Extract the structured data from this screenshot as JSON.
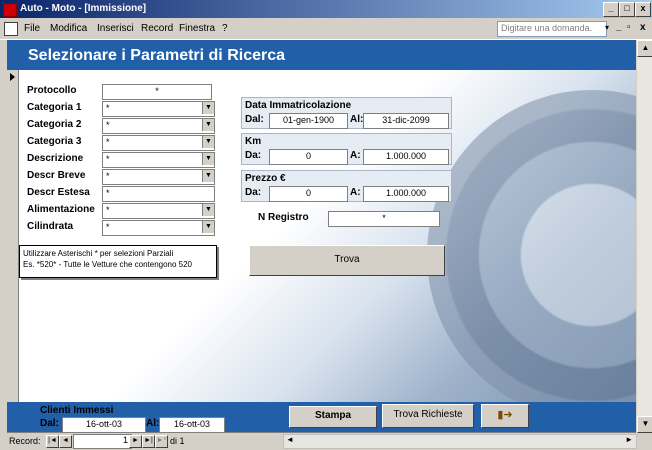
{
  "window": {
    "title": "Auto - Moto - [Immissione]",
    "buttons": {
      "minimize": "_",
      "restore": "□",
      "close": "x"
    }
  },
  "menu": {
    "items": [
      "File",
      "Modifica",
      "Inserisci",
      "Record",
      "Finestra",
      "?"
    ],
    "help_placeholder": "Digitare una domanda.",
    "mdi_buttons": {
      "minimize": "_",
      "restore": "▫",
      "close": "x"
    }
  },
  "header": {
    "title": "Selezionare i Parametri di Ricerca"
  },
  "fields": {
    "protocollo": {
      "label": "Protocollo",
      "value": "*"
    },
    "categoria1": {
      "label": "Categoria 1",
      "value": "*"
    },
    "categoria2": {
      "label": "Categoria 2",
      "value": "*"
    },
    "categoria3": {
      "label": "Categoria 3",
      "value": "*"
    },
    "descrizione": {
      "label": "Descrizione",
      "value": "*"
    },
    "descr_breve": {
      "label": "Descr Breve",
      "value": "*"
    },
    "descr_estesa": {
      "label": "Descr Estesa",
      "value": "*"
    },
    "alimentazione": {
      "label": "Alimentazione",
      "value": "*"
    },
    "cilindrata": {
      "label": "Cilindrata",
      "value": "*"
    }
  },
  "note": {
    "line1": "Utilizzare Asterischi * per selezioni Parziali",
    "line2": "Es. *520* - Tutte le Vetture che contengono 520"
  },
  "immatricolazione": {
    "title": "Data Immatricolazione",
    "from_label": "Dal:",
    "from": "01-gen-1900",
    "to_label": "Al:",
    "to": "31-dic-2099"
  },
  "km": {
    "title": "Km",
    "from_label": "Da:",
    "from": "0",
    "to_label": "A:",
    "to": "1.000.000"
  },
  "prezzo": {
    "title": "Prezzo €",
    "from_label": "Da:",
    "from": "0",
    "to_label": "A:",
    "to": "1.000.000"
  },
  "registro": {
    "label": "N Registro",
    "value": "*"
  },
  "trova_button": "Trova",
  "footer": {
    "title": "Clienti Immessi",
    "from_label": "Dal:",
    "from": "16-ott-03",
    "to_label": "Al:",
    "to": "16-ott-03",
    "stampa": "Stampa",
    "trova_richieste": "Trova Richieste"
  },
  "nav": {
    "label": "Record:",
    "current": "1",
    "of": "di 1",
    "first": "|◄",
    "prev": "◄",
    "next": "►",
    "last": "►|",
    "new": "►*"
  },
  "scroll": {
    "up": "▲",
    "down": "▼",
    "left": "◄",
    "right": "►"
  },
  "icons": {
    "exit": "exit-door-icon",
    "app": "app-icon"
  }
}
